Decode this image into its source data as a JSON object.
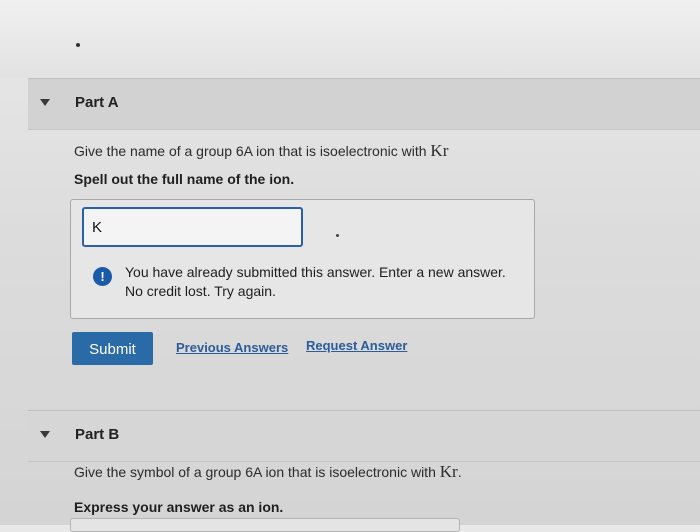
{
  "partA": {
    "title": "Part A",
    "question_text": "Give the name of a group 6A ion that is isoelectronic with ",
    "question_chem": "Kr",
    "instruction": "Spell out the full name of the ion.",
    "answer_value": "K",
    "warning_line1": "You have already submitted this answer. Enter a new answer.",
    "warning_line2": "No credit lost. Try again.",
    "warning_icon_glyph": "!",
    "warning_icon": "exclamation-icon",
    "submit_label": "Submit",
    "previous_answers_label": "Previous Answers",
    "request_answer_label": "Request Answer"
  },
  "partB": {
    "title": "Part B",
    "question_text": "Give the symbol of a group 6A ion that is isoelectronic with ",
    "question_chem": "Kr",
    "question_end": ".",
    "instruction": "Express your answer as an ion."
  },
  "colors": {
    "accent": "#2a6aa6",
    "link": "#2c5c9a",
    "input_border": "#2a5fae"
  }
}
